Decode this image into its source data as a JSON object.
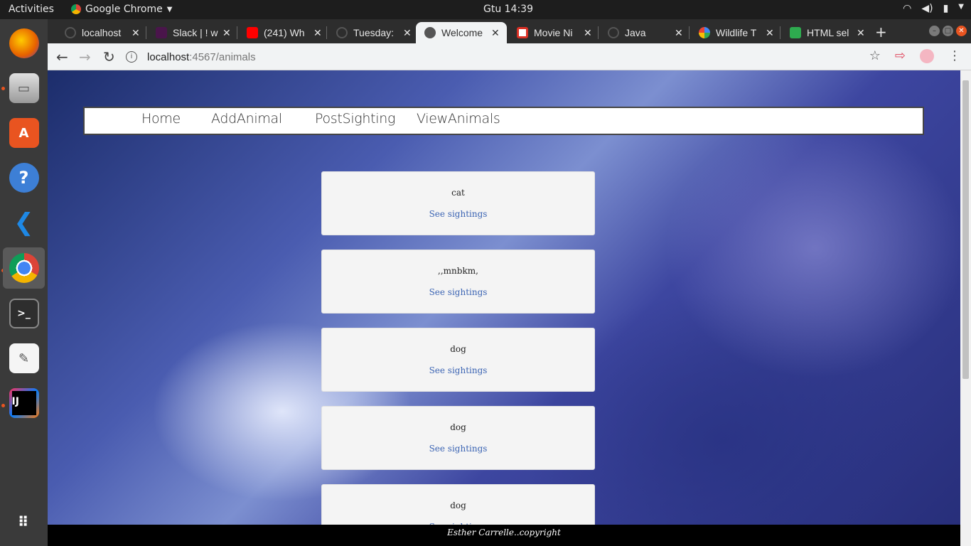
{
  "system": {
    "activities": "Activities",
    "app_name": "Google Chrome",
    "clock": "Gtu 14:39"
  },
  "dock": [
    {
      "name": "firefox",
      "icon": "firefox-icon",
      "color": "#e66000"
    },
    {
      "name": "files",
      "icon": "file-cabinet-icon",
      "color": "#9a9a9a"
    },
    {
      "name": "software",
      "icon": "shopping-bag-icon",
      "color": "#e95420"
    },
    {
      "name": "help",
      "icon": "help-icon",
      "color": "#3d7fd6"
    },
    {
      "name": "vscode",
      "icon": "vscode-icon",
      "color": "#1e88e5"
    },
    {
      "name": "chrome",
      "icon": "chrome-icon",
      "color": "#4caf50"
    },
    {
      "name": "terminal",
      "icon": "terminal-icon",
      "color": "#2e2e2e"
    },
    {
      "name": "text-editor",
      "icon": "notepad-icon",
      "color": "#f5f5f5"
    },
    {
      "name": "intellij",
      "icon": "intellij-icon",
      "color": "#111111"
    },
    {
      "name": "app-grid",
      "icon": "grid-icon",
      "color": "#3a3a3a"
    }
  ],
  "tabs": [
    {
      "label": "localhost",
      "color": "#555555"
    },
    {
      "label": "Slack | ! w",
      "color": "#4a154b"
    },
    {
      "label": "(241) Wh",
      "color": "#ff0000"
    },
    {
      "label": "Tuesday:",
      "color": "#555555"
    },
    {
      "label": "Welcome",
      "color": "#333333"
    },
    {
      "label": "Movie Ni",
      "color": "#d93025"
    },
    {
      "label": "Java",
      "color": "#555555"
    },
    {
      "label": "Wildlife T",
      "color": "#4285f4"
    },
    {
      "label": "HTML sel",
      "color": "#2eab4f"
    }
  ],
  "address": {
    "host": "localhost",
    "path": ":4567/animals"
  },
  "nav": {
    "home": "Home",
    "add_animal": "AddAnimal",
    "post_sighting": "PostSighting",
    "view_animals": "ViewAnimals"
  },
  "animals": [
    {
      "name": "cat",
      "link": "See sightings"
    },
    {
      "name": ",,mnbkm,",
      "link": "See sightings"
    },
    {
      "name": "dog",
      "link": "See sightings"
    },
    {
      "name": "dog",
      "link": "See sightings"
    },
    {
      "name": "dog",
      "link": "See sightings"
    }
  ],
  "footer": "Esther Carrelle..copyright"
}
